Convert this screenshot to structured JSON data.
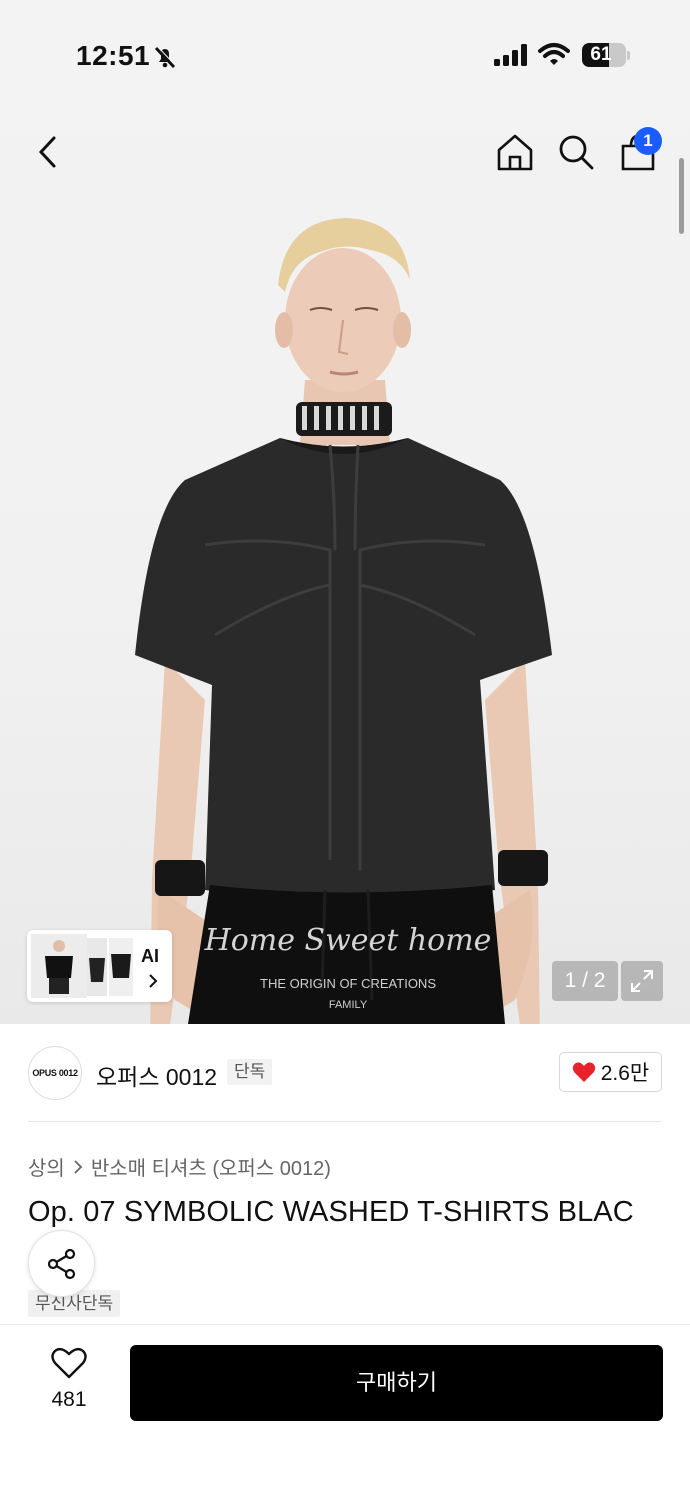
{
  "status_bar": {
    "time": "12:51",
    "battery": "61",
    "battery_level": 0.61
  },
  "nav": {
    "cart_count": "1"
  },
  "gallery": {
    "counter": "1 / 2",
    "thumb_ai_label": "AI",
    "shorts_print_line1": "Home Sweet home",
    "shorts_print_line2": "THE ORIGIN OF CREATIONS",
    "shorts_print_line3": "FAMILY"
  },
  "brand": {
    "logo_text": "OPUS 0012",
    "name": "오퍼스 0012",
    "tag": "단독",
    "likes": "2.6만"
  },
  "product": {
    "breadcrumb": [
      "상의",
      "반소매 티셔츠 (오퍼스 0012)"
    ],
    "title": "Op. 07 SYMBOLIC WASHED T-SHIRTS BLAC",
    "exclusive_tag": "무신사단독"
  },
  "bottom_bar": {
    "wish_count": "481",
    "buy_label": "구매하기"
  },
  "colors": {
    "accent_blue": "#1a5cff",
    "like_red": "#e8222d",
    "buy_bg": "#000000"
  }
}
